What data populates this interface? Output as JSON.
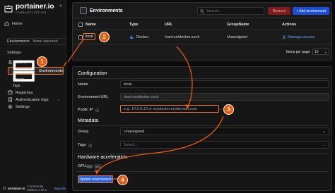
{
  "sidebar": {
    "brand": "portainer.io",
    "brand_sub": "COMMUNITY EDITION",
    "collapse_glyph": "«",
    "home": "Home",
    "environment_label": "Environment:",
    "environment_value": "None selected",
    "settings_section": "Settings",
    "users": "Users",
    "environments": "Environments",
    "groups": "Groups",
    "tags": "Tags",
    "registries": "Registries",
    "auth_logs": "Authentication logs",
    "settings": "Settings"
  },
  "footer": {
    "brand": "portainer.io",
    "edition": "Community Edition 2.19.3",
    "upgrade": "Upgrade"
  },
  "environments": {
    "title": "Environments",
    "search_placeholder": "Search...",
    "remove_label": "Remove",
    "add_label": "+ Add environment",
    "columns": {
      "name": "Name",
      "type": "Type",
      "url": "URL",
      "group": "GroupName",
      "actions": "Actions"
    },
    "row": {
      "name": "local",
      "type": "Docker",
      "url": "/var/run/docker.sock",
      "group": "Unassigned",
      "action": "Manage access"
    },
    "items_per_page_label": "Items per page",
    "items_per_page_value": "10"
  },
  "configuration": {
    "section_title": "Configuration",
    "name_label": "Name",
    "name_value": "local",
    "url_label": "Environment URL",
    "url_value": "/var/run/docker.sock",
    "public_ip_label": "Public IP",
    "public_ip_placeholder": "e.g. 10.0.0.10 or mydocker.mydomain.com",
    "metadata_title": "Metadata",
    "group_label": "Group",
    "group_value": "Unassigned",
    "tags_label": "Tags",
    "tags_placeholder": "Select...",
    "hw_title": "Hardware acceleration",
    "gpu_label": "GPU",
    "gpu_badge": "add",
    "update_label": "Update environment"
  },
  "callouts": [
    "1",
    "2",
    "3",
    "4"
  ],
  "colors": {
    "accent": "#f97316",
    "primary": "#2563eb",
    "danger": "#7f1d1d",
    "background": "#0a0a0a",
    "panel": "#1a1a1a"
  }
}
